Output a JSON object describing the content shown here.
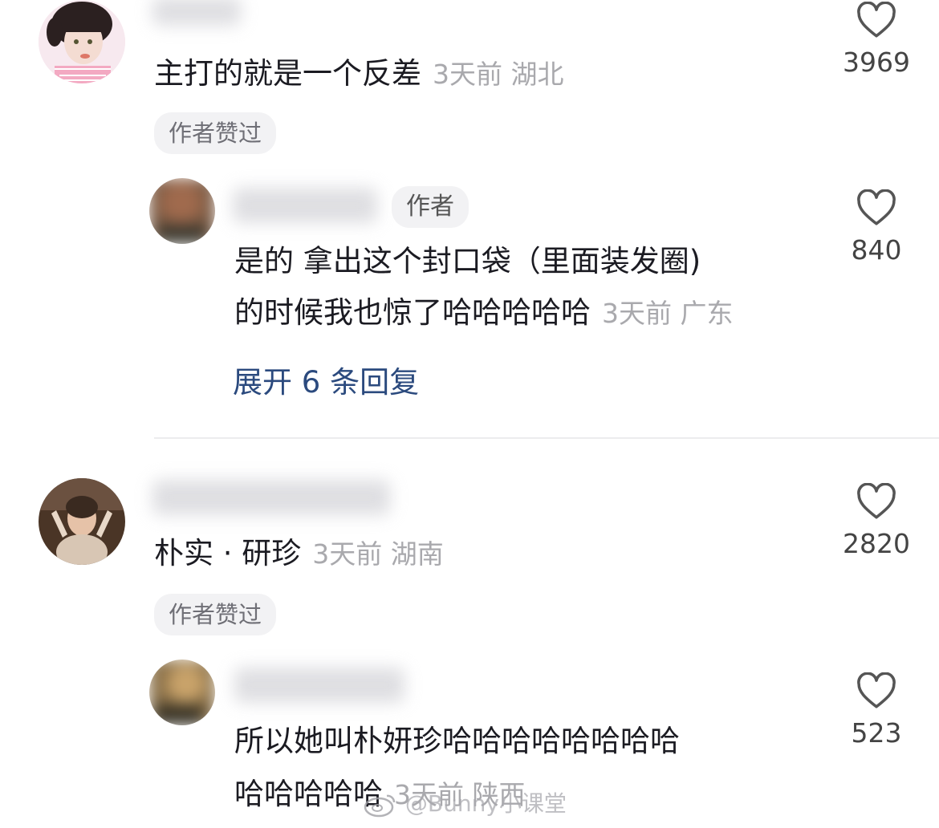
{
  "comments": [
    {
      "text": "主打的就是一个反差",
      "time": "3天前",
      "location": "湖北",
      "likes": "3969",
      "badge": "作者赞过",
      "reply": {
        "tag": "作者",
        "text_line1": "是的 拿出这个封口袋（里面装发圈)",
        "text_line2": "的时候我也惊了哈哈哈哈哈",
        "time": "3天前",
        "location": "广东",
        "likes": "840"
      },
      "expand": "展开 6 条回复"
    },
    {
      "text": "朴实 · 研珍",
      "time": "3天前",
      "location": "湖南",
      "likes": "2820",
      "badge": "作者赞过",
      "reply": {
        "text_line1": "所以她叫朴妍珍哈哈哈哈哈哈哈哈",
        "text_line2": "哈哈哈哈哈",
        "time": "3天前",
        "location": "陕西",
        "likes": "523"
      }
    }
  ],
  "watermark": "@Bunny小课堂",
  "icons": {
    "like": "heart-outline-icon",
    "weibo": "weibo-logo-icon"
  }
}
